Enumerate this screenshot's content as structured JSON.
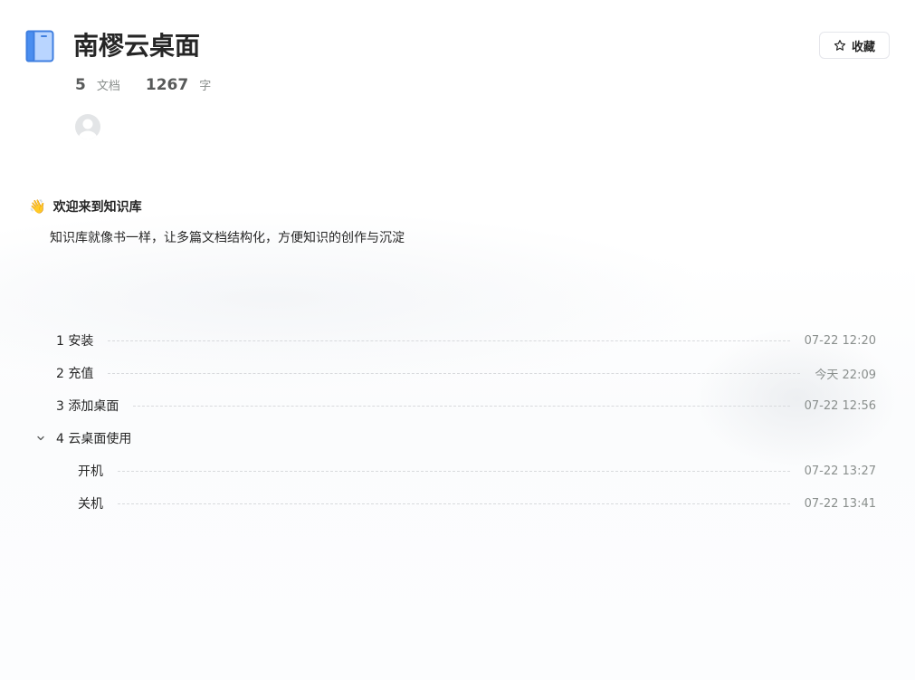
{
  "book": {
    "title": "南樛云桌面",
    "icon": "book-icon",
    "doc_count": "5",
    "doc_unit": "文档",
    "word_count": "1267",
    "word_unit": "字"
  },
  "actions": {
    "favorite_label": "收藏",
    "favorite_icon": "star-icon"
  },
  "welcome": {
    "emoji": "👋",
    "title": "欢迎来到知识库",
    "description": "知识库就像书一样，让多篇文档结构化，方便知识的创作与沉淀"
  },
  "toc": [
    {
      "title": "1 安装",
      "time": "07-22 12:20"
    },
    {
      "title": "2 充值",
      "time": "今天 22:09"
    },
    {
      "title": "3 添加桌面",
      "time": "07-22 12:56"
    },
    {
      "title": "4 云桌面使用",
      "time": ""
    },
    {
      "title": "开机",
      "time": "07-22 13:27"
    },
    {
      "title": "关机",
      "time": "07-22 13:41"
    }
  ],
  "colors": {
    "accent_blue": "#4a8ef0",
    "text": "#262626",
    "muted": "#8a8f8d"
  }
}
